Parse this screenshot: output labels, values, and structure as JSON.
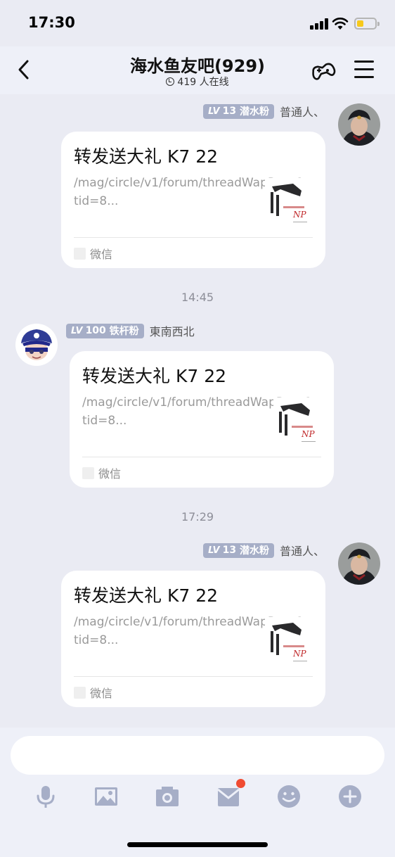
{
  "status_bar": {
    "time": "17:30"
  },
  "header": {
    "title": "海水鱼友吧(929)",
    "online": "419 人在线"
  },
  "messages": [
    {
      "side": "right",
      "level_prefix": "LV",
      "level": "13",
      "fan_title": "潜水粉",
      "nickname": "普通人、",
      "card": {
        "title": "转发送大礼 K7 22",
        "desc": "/mag/circle/v1/forum/threadWapPage?tid=8...",
        "source": "微信",
        "thumb_text": "NP"
      }
    },
    {
      "time": "14:45"
    },
    {
      "side": "left",
      "level_prefix": "LV",
      "level": "100",
      "fan_title": "铁杆粉",
      "nickname": "東南西北",
      "card": {
        "title": "转发送大礼 K7 22",
        "desc": "/mag/circle/v1/forum/threadWapPage?tid=8...",
        "source": "微信",
        "thumb_text": "NP"
      }
    },
    {
      "time": "17:29"
    },
    {
      "side": "right",
      "level_prefix": "LV",
      "level": "13",
      "fan_title": "潜水粉",
      "nickname": "普通人、",
      "card": {
        "title": "转发送大礼 K7 22",
        "desc": "/mag/circle/v1/forum/threadWapPage?tid=8...",
        "source": "微信",
        "thumb_text": "NP"
      }
    }
  ],
  "input": {
    "placeholder": ""
  },
  "toolbar": [
    "microphone-icon",
    "image-icon",
    "camera-icon",
    "gift-mail-icon",
    "emoji-icon",
    "plus-icon"
  ],
  "colors": {
    "background": "#eaebf3",
    "badge": "#a6aec7",
    "notification_dot": "#f04b32",
    "battery": "#f7c91b"
  }
}
